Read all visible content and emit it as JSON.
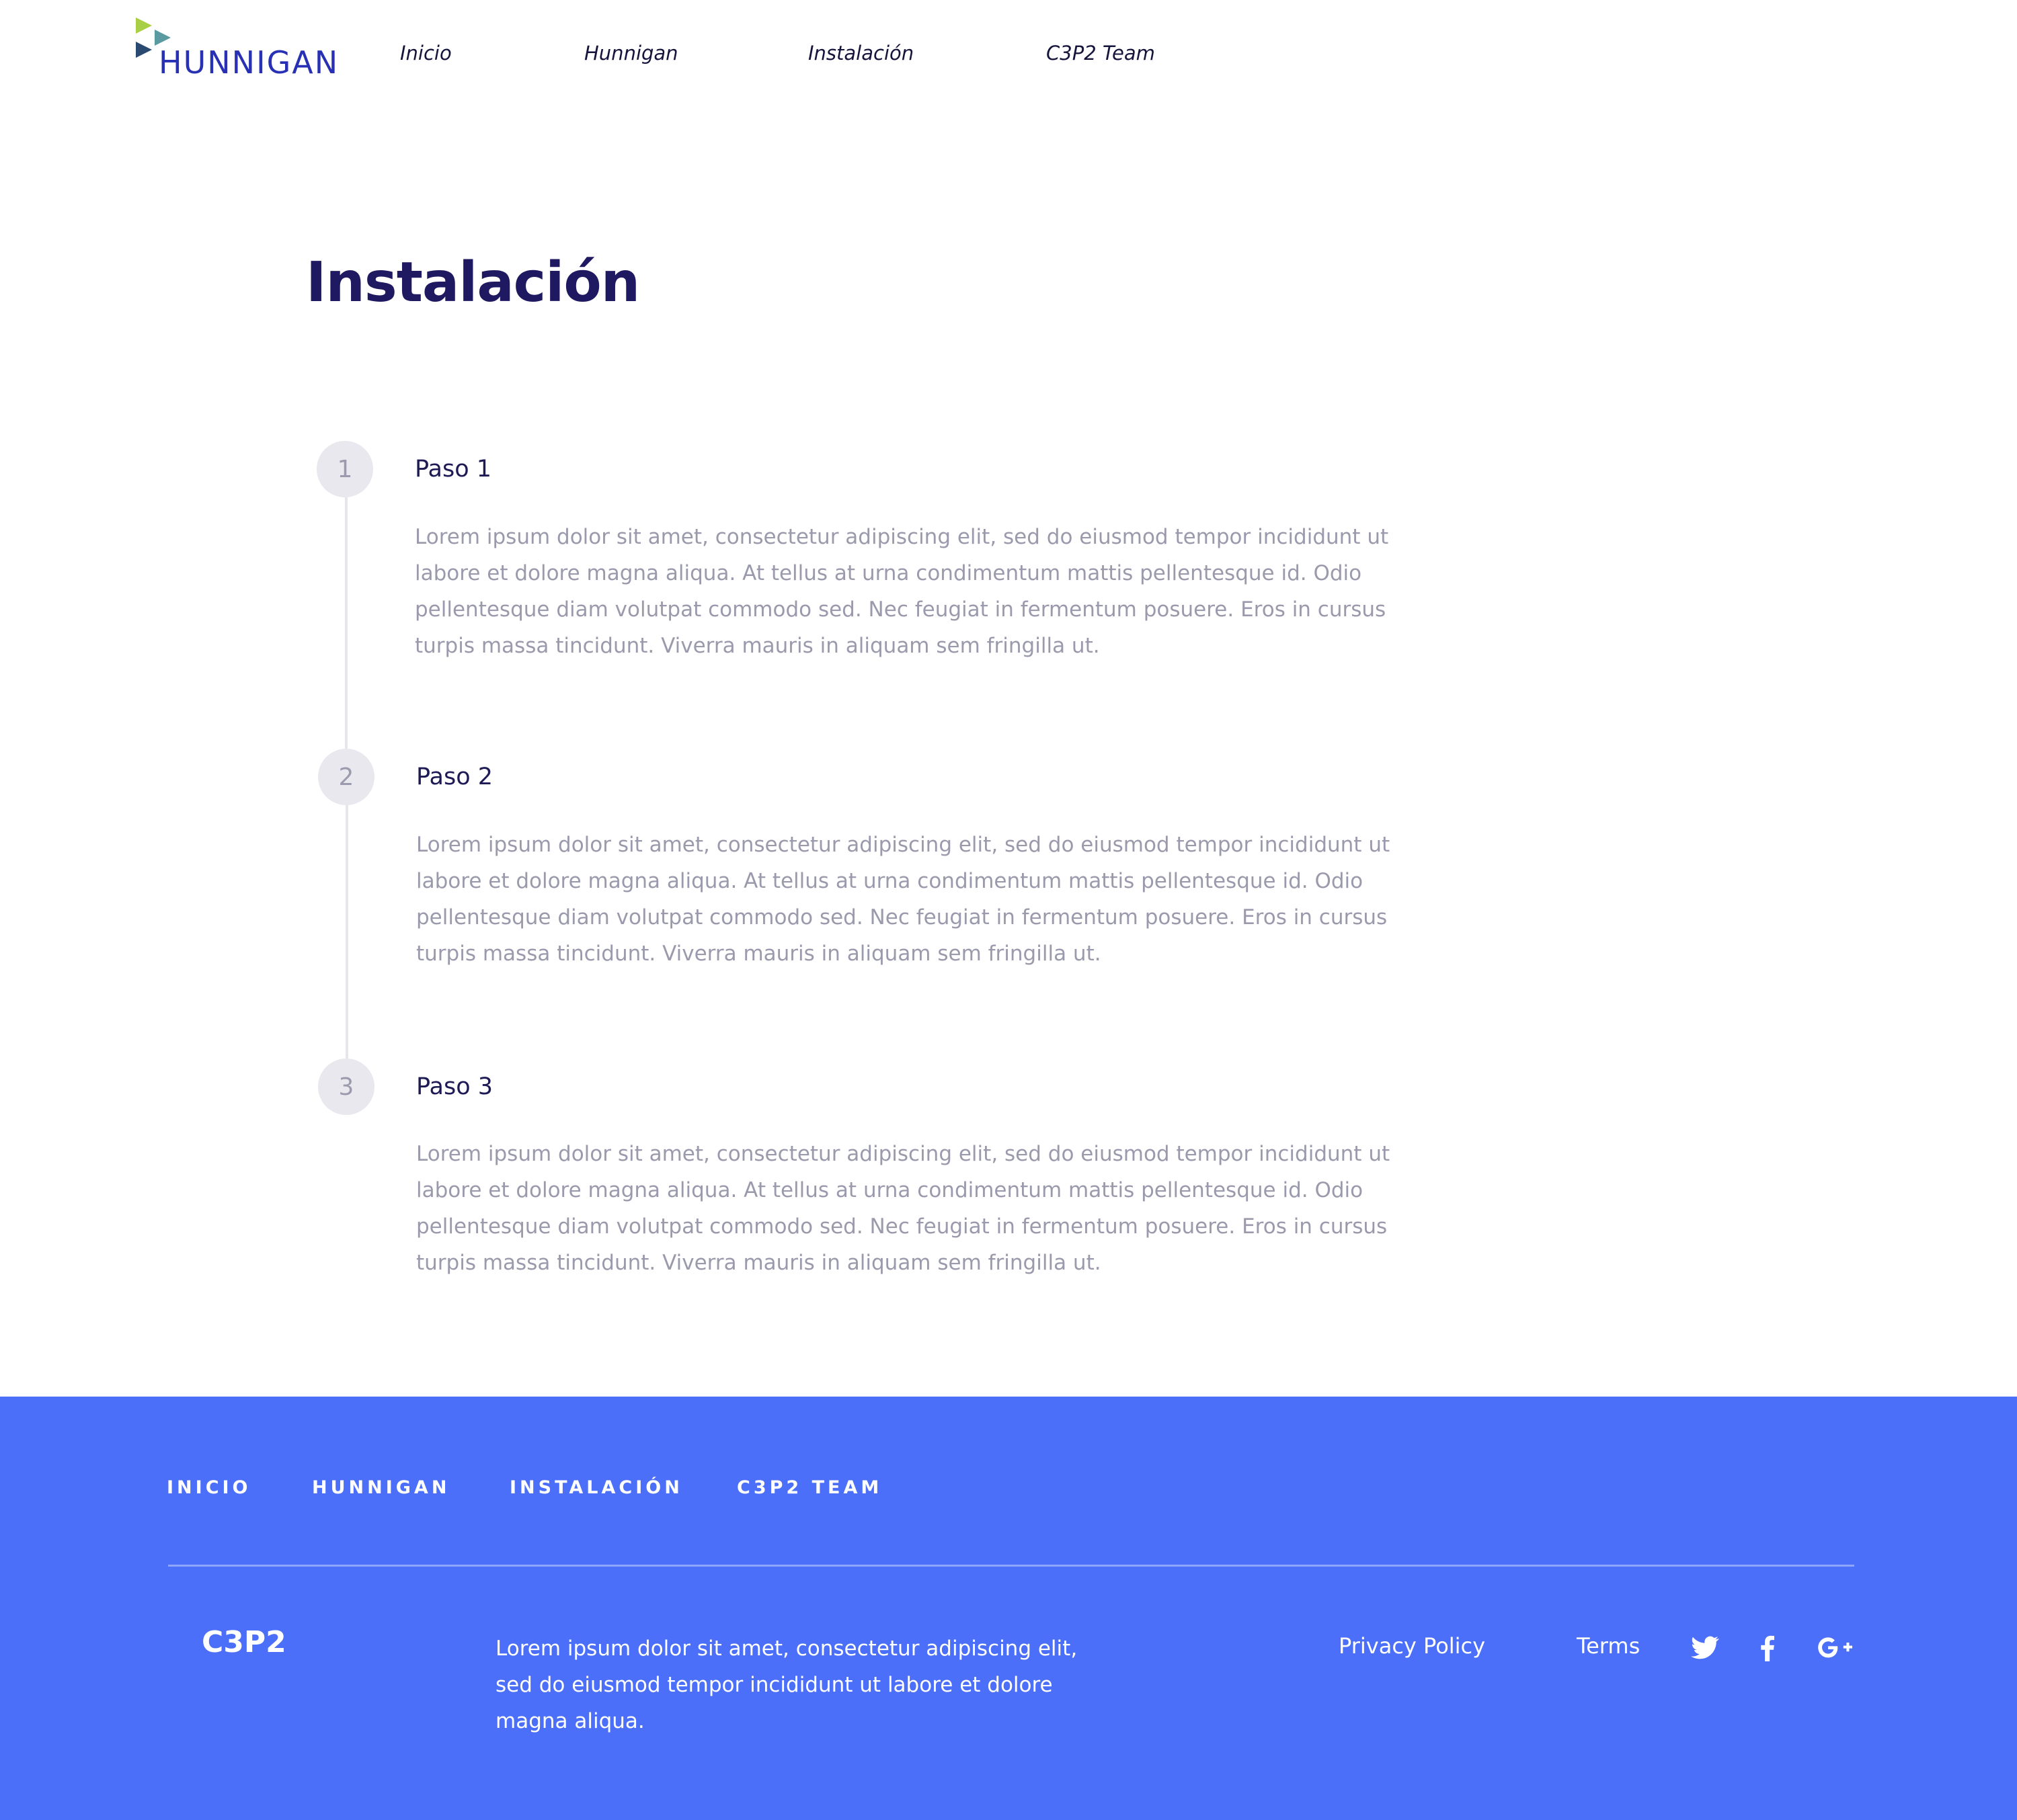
{
  "header": {
    "logo_text": "HUNNIGAN",
    "nav": [
      "Inicio",
      "Hunnigan",
      "Instalación",
      "C3P2 Team"
    ]
  },
  "main": {
    "title": "Instalación",
    "steps": [
      {
        "number": "1",
        "title": "Paso 1",
        "text": "Lorem ipsum dolor sit amet, consectetur adipiscing elit, sed do eiusmod tempor incididunt ut labore et dolore magna aliqua. At tellus at urna condimentum mattis pellentesque id. Odio pellentesque diam volutpat commodo sed. Nec feugiat in fermentum posuere. Eros in cursus turpis massa tincidunt. Viverra mauris in aliquam sem fringilla ut."
      },
      {
        "number": "2",
        "title": "Paso 2",
        "text": "Lorem ipsum dolor sit amet, consectetur adipiscing elit, sed do eiusmod tempor incididunt ut labore et dolore magna aliqua. At tellus at urna condimentum mattis pellentesque id. Odio pellentesque diam volutpat commodo sed. Nec feugiat in fermentum posuere. Eros in cursus turpis massa tincidunt. Viverra mauris in aliquam sem fringilla ut."
      },
      {
        "number": "3",
        "title": "Paso 3",
        "text": "Lorem ipsum dolor sit amet, consectetur adipiscing elit, sed do eiusmod tempor incididunt ut labore et dolore magna aliqua. At tellus at urna condimentum mattis pellentesque id. Odio pellentesque diam volutpat commodo sed. Nec feugiat in fermentum posuere. Eros in cursus turpis massa tincidunt. Viverra mauris in aliquam sem fringilla ut."
      }
    ]
  },
  "footer": {
    "nav": [
      "INICIO",
      "HUNNIGAN",
      "INSTALACIÓN",
      "C3P2 TEAM"
    ],
    "brand": "C3P2",
    "description": "Lorem ipsum dolor sit amet, consectetur adipiscing elit, sed do eiusmod tempor incididunt ut labore et dolore magna aliqua.",
    "privacy": "Privacy Policy",
    "terms": "Terms",
    "social_icons": [
      "twitter-icon",
      "facebook-icon",
      "google-plus-icon"
    ]
  },
  "colors": {
    "title": "#1e1960",
    "footer_bg": "#4b6ff8",
    "logo_blue": "#2830b4",
    "logo_green": "#a8cf45",
    "logo_teal": "#5b9aa0",
    "logo_navy": "#2b4a72"
  }
}
